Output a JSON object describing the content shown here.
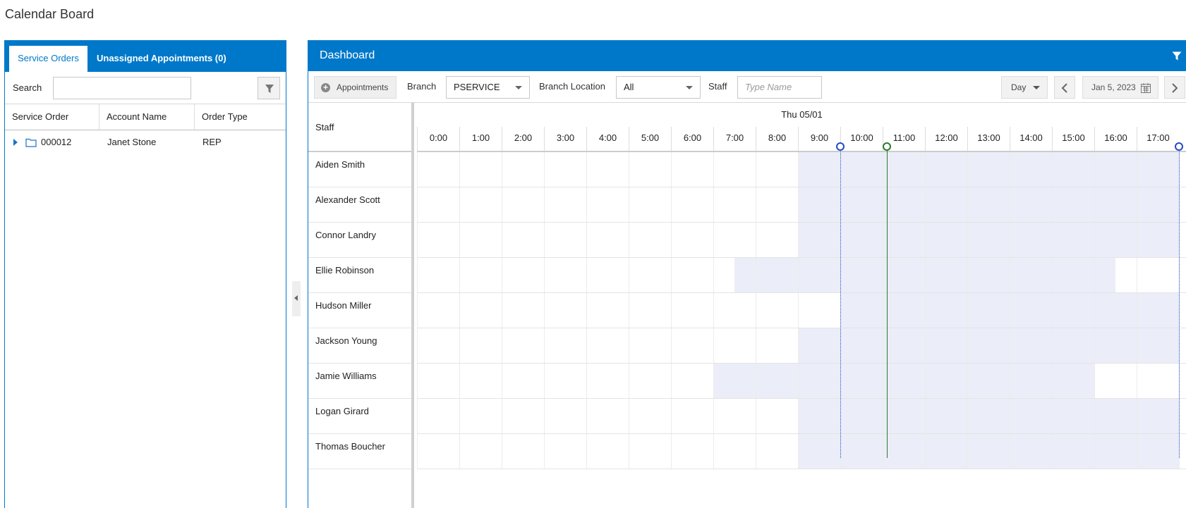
{
  "page": {
    "title": "Calendar Board"
  },
  "left_panel": {
    "tabs": [
      {
        "label": "Service Orders",
        "active": true
      },
      {
        "label": "Unassigned Appointments (0)",
        "active": false
      }
    ],
    "search_label": "Search",
    "search_value": "",
    "columns": [
      "Service Order",
      "Account Name",
      "Order Type"
    ],
    "rows": [
      {
        "order": "000012",
        "account": "Janet Stone",
        "type": "REP"
      }
    ]
  },
  "dashboard": {
    "title": "Dashboard",
    "toolbar": {
      "appointments_label": "Appointments",
      "branch_label": "Branch",
      "branch_value": "PSERVICE",
      "branch_location_label": "Branch Location",
      "branch_location_value": "All",
      "staff_label": "Staff",
      "staff_placeholder": "Type Name",
      "view_value": "Day",
      "date_value": "Jan 5, 2023"
    },
    "scheduler": {
      "staff_header": "Staff",
      "date_header": "Thu 05/01",
      "hours": [
        "0:00",
        "1:00",
        "2:00",
        "3:00",
        "4:00",
        "5:00",
        "6:00",
        "7:00",
        "8:00",
        "9:00",
        "10:00",
        "11:00",
        "12:00",
        "13:00",
        "14:00",
        "15:00",
        "16:00",
        "17:00"
      ],
      "staff": [
        {
          "name": "Aiden Smith",
          "available": [
            [
              9,
              18
            ]
          ]
        },
        {
          "name": "Alexander Scott",
          "available": [
            [
              9,
              18
            ]
          ]
        },
        {
          "name": "Connor Landry",
          "available": [
            [
              9,
              18
            ]
          ]
        },
        {
          "name": "Ellie Robinson",
          "available": [
            [
              7.5,
              16.5
            ]
          ]
        },
        {
          "name": "Hudson Miller",
          "available": [
            [
              10,
              18
            ]
          ]
        },
        {
          "name": "Jackson Young",
          "available": [
            [
              9,
              18
            ]
          ]
        },
        {
          "name": "Jamie Williams",
          "available": [
            [
              7,
              16
            ]
          ]
        },
        {
          "name": "Logan Girard",
          "available": [
            [
              9,
              18
            ]
          ]
        },
        {
          "name": "Thomas Boucher",
          "available": [
            [
              9,
              18
            ]
          ]
        }
      ],
      "markers": [
        {
          "hour": 10,
          "color": "#2349c8"
        },
        {
          "hour": 11.1,
          "color": "#2d7a2d"
        },
        {
          "hour": 18,
          "color": "#2349c8"
        }
      ]
    }
  },
  "colors": {
    "accent": "#0078c9",
    "availability": "#ebedf8"
  }
}
